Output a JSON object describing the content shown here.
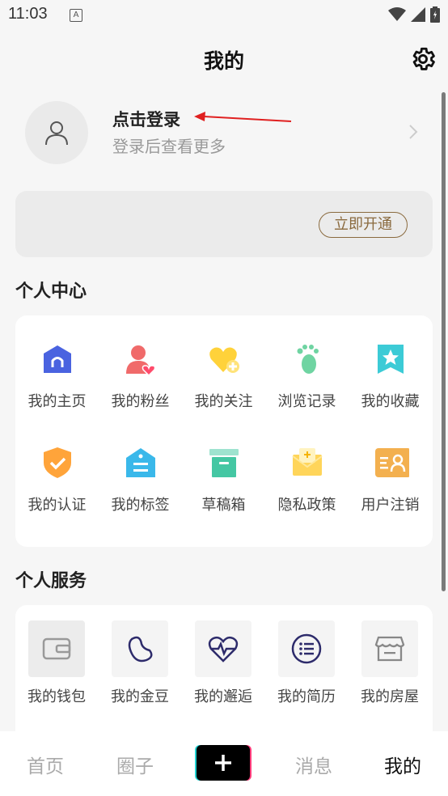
{
  "status": {
    "time": "11:03",
    "notif_letter": "A"
  },
  "header": {
    "title": "我的"
  },
  "login": {
    "title": "点击登录",
    "subtitle": "登录后查看更多"
  },
  "vip": {
    "button": "立即开通"
  },
  "personal_center": {
    "title": "个人中心",
    "items": [
      {
        "label": "我的主页",
        "icon": "home-icon"
      },
      {
        "label": "我的粉丝",
        "icon": "fans-icon"
      },
      {
        "label": "我的关注",
        "icon": "follow-heart-icon"
      },
      {
        "label": "浏览记录",
        "icon": "footprint-icon"
      },
      {
        "label": "我的收藏",
        "icon": "star-bookmark-icon"
      },
      {
        "label": "我的认证",
        "icon": "shield-check-icon"
      },
      {
        "label": "我的标签",
        "icon": "tag-icon"
      },
      {
        "label": "草稿箱",
        "icon": "draft-box-icon"
      },
      {
        "label": "隐私政策",
        "icon": "privacy-envelope-icon"
      },
      {
        "label": "用户注销",
        "icon": "user-card-icon"
      }
    ]
  },
  "personal_services": {
    "title": "个人服务",
    "items": [
      {
        "label": "我的钱包",
        "icon": "wallet-icon"
      },
      {
        "label": "我的金豆",
        "icon": "bean-icon"
      },
      {
        "label": "我的邂逅",
        "icon": "heartbeat-icon"
      },
      {
        "label": "我的简历",
        "icon": "list-icon"
      },
      {
        "label": "我的房屋",
        "icon": "store-icon"
      }
    ]
  },
  "tabbar": {
    "home": "首页",
    "circle": "圈子",
    "messages": "消息",
    "mine": "我的"
  }
}
